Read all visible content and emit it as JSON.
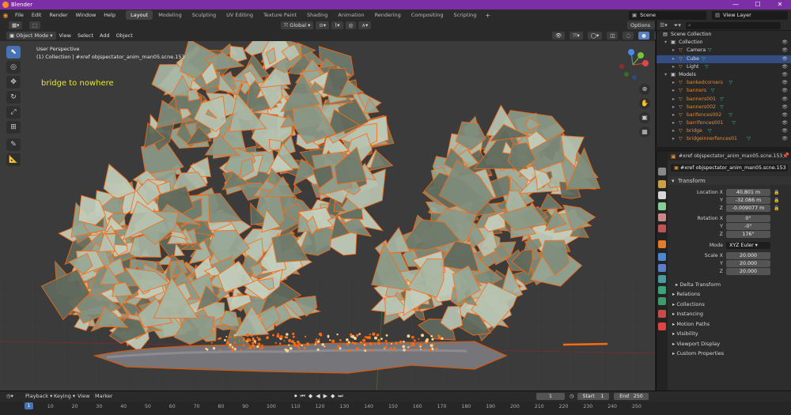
{
  "window": {
    "title": "Blender",
    "controls": [
      "—",
      "☐",
      "✕"
    ]
  },
  "menubar": {
    "menus": [
      "File",
      "Edit",
      "Render",
      "Window",
      "Help"
    ],
    "workspaces": [
      "Layout",
      "Modeling",
      "Sculpting",
      "UV Editing",
      "Texture Paint",
      "Shading",
      "Animation",
      "Rendering",
      "Compositing",
      "Scripting"
    ],
    "active_workspace": "Layout",
    "add_workspace": "+",
    "scene": "Scene",
    "view_layer": "View Layer"
  },
  "viewport_header": {
    "mode": "Object Mode",
    "menus": [
      "View",
      "Select",
      "Add",
      "Object"
    ],
    "transform_orientation": "Global",
    "options": "Options"
  },
  "viewport": {
    "perspective": "User Perspective",
    "collection_info": "(1) Collection | #xref objspectator_anim_man05.scne.153",
    "annotation": "bridge to nowhere",
    "accent": "#ff6a10",
    "shard_color": "#9aa89a"
  },
  "toolbar": {
    "tools": [
      "select-box-icon",
      "cursor-icon",
      "move-icon",
      "rotate-icon",
      "scale-icon",
      "transform-icon",
      "annotate-icon",
      "measure-icon"
    ]
  },
  "outliner": {
    "search_placeholder": "",
    "rows": [
      {
        "name": "Scene Collection",
        "indent": 0,
        "type": "scene"
      },
      {
        "name": "Collection",
        "indent": 1,
        "type": "collection"
      },
      {
        "name": "Camera",
        "indent": 2,
        "type": "object"
      },
      {
        "name": "Cube",
        "indent": 2,
        "type": "object",
        "selected": true
      },
      {
        "name": "Light",
        "indent": 2,
        "type": "object"
      },
      {
        "name": "Models",
        "indent": 1,
        "type": "collection"
      },
      {
        "name": "bankedcorners",
        "indent": 2,
        "type": "object"
      },
      {
        "name": "banners",
        "indent": 2,
        "type": "object"
      },
      {
        "name": "banners001",
        "indent": 2,
        "type": "object"
      },
      {
        "name": "banners002",
        "indent": 2,
        "type": "object"
      },
      {
        "name": "barifences002",
        "indent": 2,
        "type": "object"
      },
      {
        "name": "barrifences001",
        "indent": 2,
        "type": "object"
      },
      {
        "name": "bridge",
        "indent": 2,
        "type": "object"
      },
      {
        "name": "bridgeinnerfences01",
        "indent": 2,
        "type": "object"
      }
    ]
  },
  "properties": {
    "object_name": "#xref objspectator_anim_man05.scne.153",
    "object_field": "#xref objspectator_anim_man05.scne.153",
    "transform_label": "Transform",
    "location": {
      "label": "Location X",
      "x": "40.801 m",
      "y": "-32.086 m",
      "z": "-0.009077 m"
    },
    "rotation": {
      "label": "Rotation X",
      "x": "0°",
      "y": "-0°",
      "z": "176°"
    },
    "mode_label": "Mode",
    "mode": "XYZ Euler",
    "scale": {
      "label": "Scale X",
      "x": "20.000",
      "y": "20.000",
      "z": "20.000"
    },
    "axis_y": "Y",
    "axis_z": "Z",
    "delta": "Delta Transform",
    "sections": [
      "Relations",
      "Collections",
      "Instancing",
      "Motion Paths",
      "Visibility",
      "Viewport Display",
      "Custom Properties"
    ]
  },
  "timeline": {
    "menus": [
      "Playback",
      "Keying",
      "View",
      "Marker"
    ],
    "current_frame": "1",
    "start_label": "Start",
    "start": "1",
    "end_label": "End",
    "end": "250",
    "ticks": [
      "1",
      "10",
      "20",
      "30",
      "40",
      "50",
      "60",
      "70",
      "80",
      "90",
      "100",
      "110",
      "120",
      "130",
      "140",
      "150",
      "160",
      "170",
      "180",
      "190",
      "200",
      "210",
      "220",
      "230",
      "240",
      "250"
    ]
  }
}
